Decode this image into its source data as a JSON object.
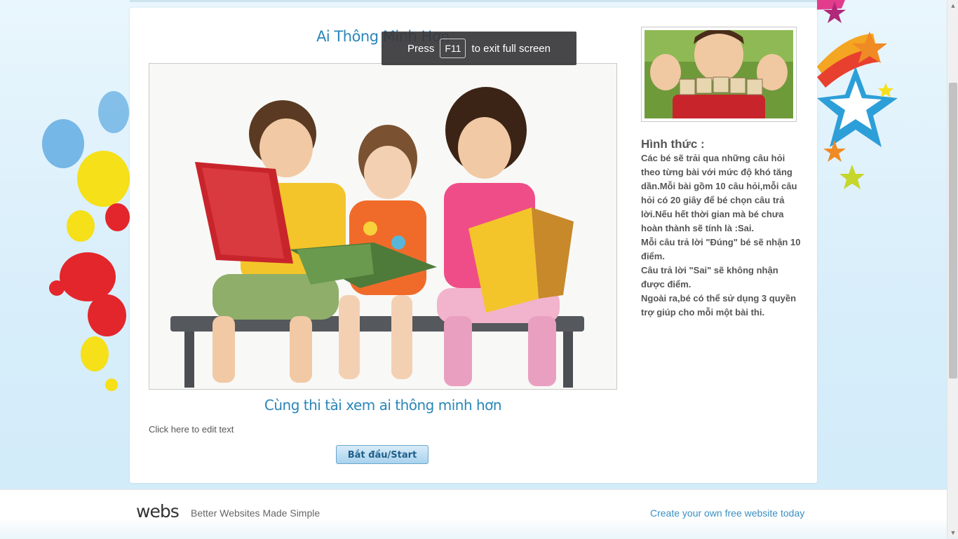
{
  "page": {
    "title": "Ai Thông Minh Hơn",
    "subtitle": "Cùng thi tài xem ai thông minh hơn",
    "edit_text": "Click here to edit text",
    "start_button": "Bắt đầu/Start"
  },
  "fullscreen_toast": {
    "press": "Press",
    "key": "F11",
    "rest": "to exit full screen"
  },
  "sidebar": {
    "photo_text": "LEARN",
    "rules_heading": "Hình thức :",
    "rules": [
      "Các bé sẽ trải qua những câu hỏi theo từng bài với mức độ khó tăng dần.Mỗi bài gồm 10 câu hỏi,mỗi câu hỏi có 20 giây để bé chọn câu trả lời.Nếu hết thời gian mà bé chưa hoàn thành sẽ tính là :Sai.",
      "Mỗi câu trả lời \"Đúng\" bé sẽ nhận 10 điểm.",
      "Câu trả lời \"Sai\" sẽ không nhận được điểm.",
      "Ngoài ra,bé có thể sử dụng 3 quyền trợ giúp cho mỗi một bài thi."
    ]
  },
  "footer": {
    "logo": "webs",
    "tagline": "Better Websites Made Simple",
    "link": "Create your own free website today"
  },
  "colors": {
    "accent": "#2a86b8",
    "text": "#555555",
    "button_bg": "#a9d3ee"
  }
}
